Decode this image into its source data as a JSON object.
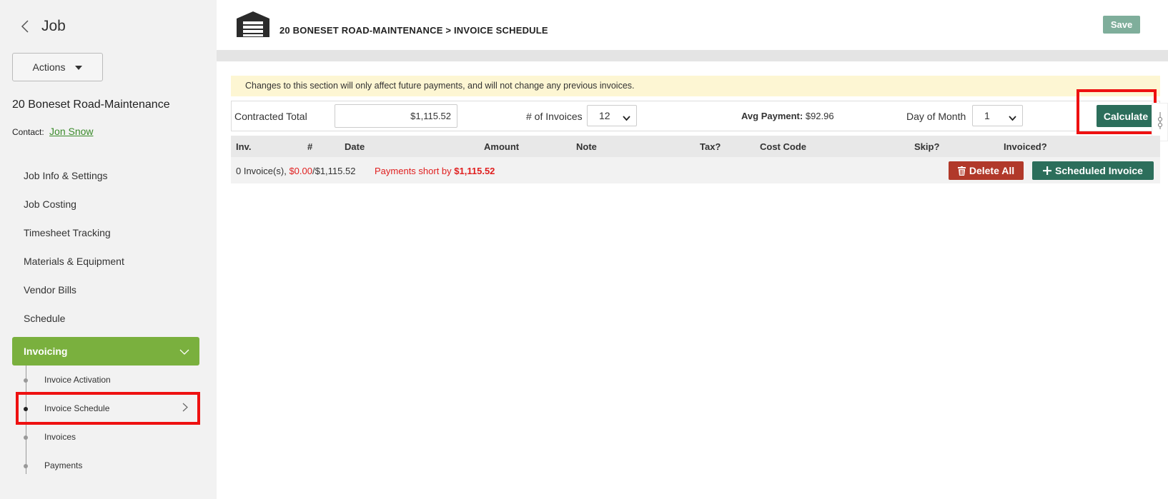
{
  "sidebar": {
    "back_title": "Job",
    "actions_label": "Actions",
    "job_name": "20 Boneset Road-Maintenance",
    "contact_label": "Contact:",
    "contact_name": "Jon Snow",
    "nav": [
      "Job Info & Settings",
      "Job Costing",
      "Timesheet Tracking",
      "Materials & Equipment",
      "Vendor Bills",
      "Schedule"
    ],
    "active_section": "Invoicing",
    "sub_items": [
      "Invoice Activation",
      "Invoice Schedule",
      "Invoices",
      "Payments"
    ]
  },
  "header": {
    "breadcrumb": "20 BONESET ROAD-MAINTENANCE > INVOICE SCHEDULE",
    "save_label": "Save"
  },
  "notice": "Changes to this section will only affect future payments, and will not change any previous invoices.",
  "calc": {
    "contracted_total_label": "Contracted Total",
    "contracted_total_value": "$1,115.52",
    "num_invoices_label": "# of Invoices",
    "num_invoices_value": "12",
    "avg_payment_label": "Avg Payment:",
    "avg_payment_value": "$92.96",
    "day_of_month_label": "Day of Month",
    "day_of_month_value": "1",
    "calculate_label": "Calculate"
  },
  "table": {
    "columns": [
      "Inv.",
      "#",
      "Date",
      "Amount",
      "Note",
      "Tax?",
      "Cost Code",
      "Skip?",
      "Invoiced?"
    ]
  },
  "summary": {
    "count_text": "0 Invoice(s),",
    "invoiced_amount": "$0.00",
    "total_text": "/$1,115.52",
    "short_label": "Payments short by",
    "short_amount": "$1,115.52",
    "delete_all_label": "Delete All",
    "scheduled_invoice_label": "Scheduled Invoice"
  },
  "colors": {
    "accent_green": "#7ab03e",
    "button_green": "#2c6e5b",
    "delete_red": "#b1392a",
    "highlight_red": "#ee1111"
  }
}
